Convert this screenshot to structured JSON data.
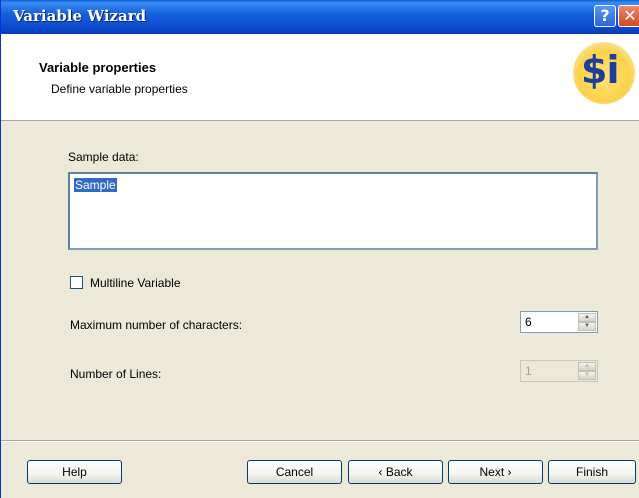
{
  "window": {
    "title": "Variable Wizard",
    "help_glyph": "?",
    "close_glyph": "✕"
  },
  "header": {
    "title": "Variable properties",
    "subtitle": "Define variable properties",
    "logo_text": "$i"
  },
  "form": {
    "sample_label": "Sample data:",
    "sample_value": "Sample",
    "multiline_label": "Multiline Variable",
    "multiline_checked": false,
    "max_chars_label": "Maximum number of characters:",
    "max_chars_value": "6",
    "lines_label": "Number of Lines:",
    "lines_value": "1",
    "spin_up": "▲",
    "spin_down": "▼"
  },
  "buttons": {
    "help": "Help",
    "cancel": "Cancel",
    "back": "‹ Back",
    "next": "Next ›",
    "finish": "Finish"
  }
}
